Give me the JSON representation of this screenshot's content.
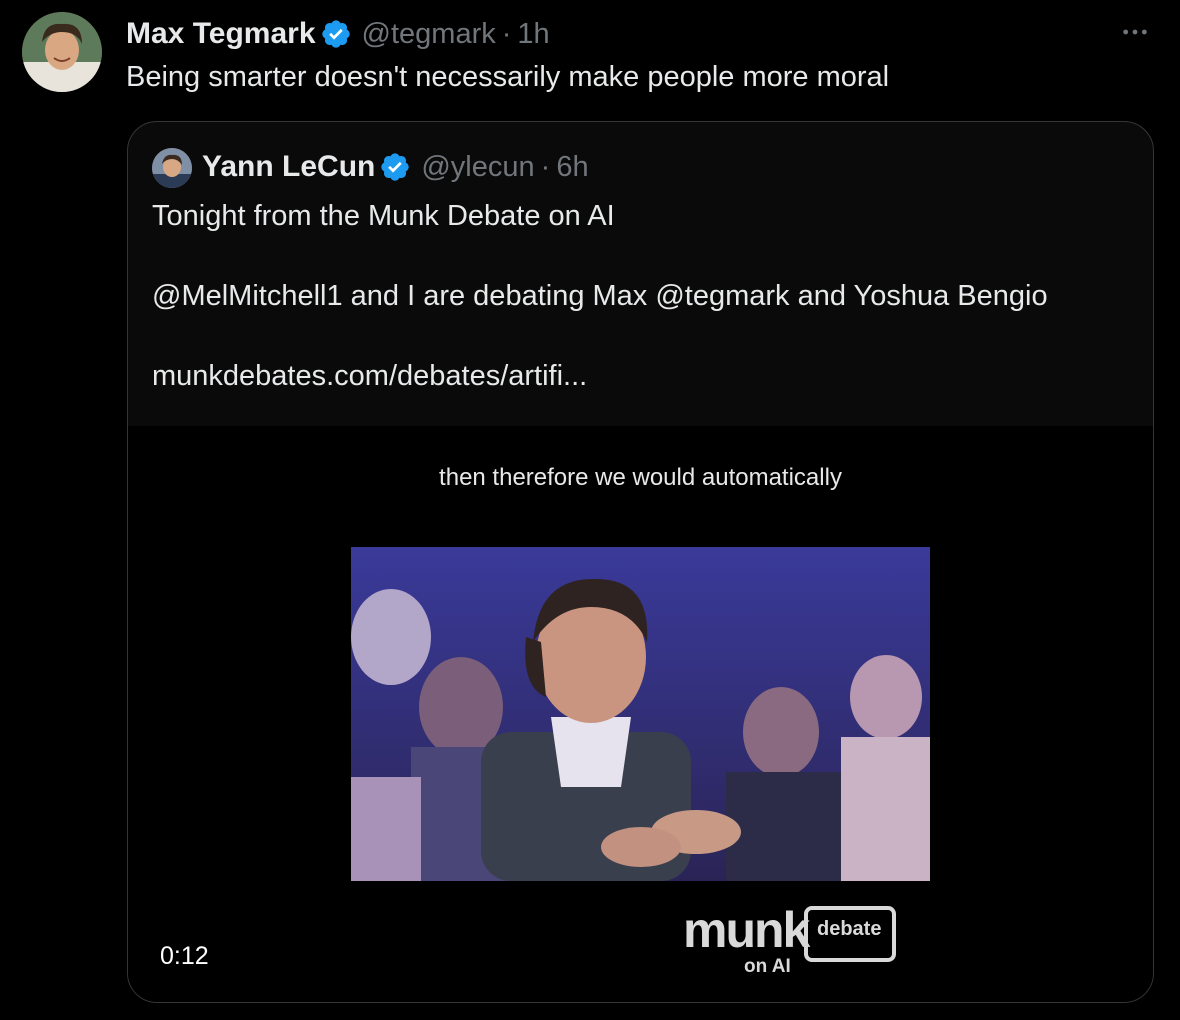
{
  "tweet": {
    "author_name": "Max Tegmark",
    "handle": "@tegmark",
    "separator": "·",
    "time": "1h",
    "verified_icon": "verified-badge-icon",
    "more_icon": "more-options-icon",
    "text": "Being smarter doesn't necessarily make people more moral"
  },
  "quoted_tweet": {
    "author_name": "Yann LeCun",
    "handle": "@ylecun",
    "separator": "·",
    "time": "6h",
    "verified_icon": "verified-badge-icon",
    "text_line_1": "Tonight from the Munk Debate on AI",
    "text_line_2": "@MelMitchell1 and I are debating Max @tegmark and Yoshua Bengio",
    "link": "munkdebates.com/debates/artifi..."
  },
  "video": {
    "caption": "then therefore we would automatically",
    "duration": "0:12",
    "logo_main": "munk",
    "logo_box": "debate",
    "logo_sub": "on AI"
  },
  "colors": {
    "background": "#000000",
    "text": "#e7e9ea",
    "secondary_text": "#71767b",
    "border": "#333639",
    "verified": "#1d9bf0"
  }
}
